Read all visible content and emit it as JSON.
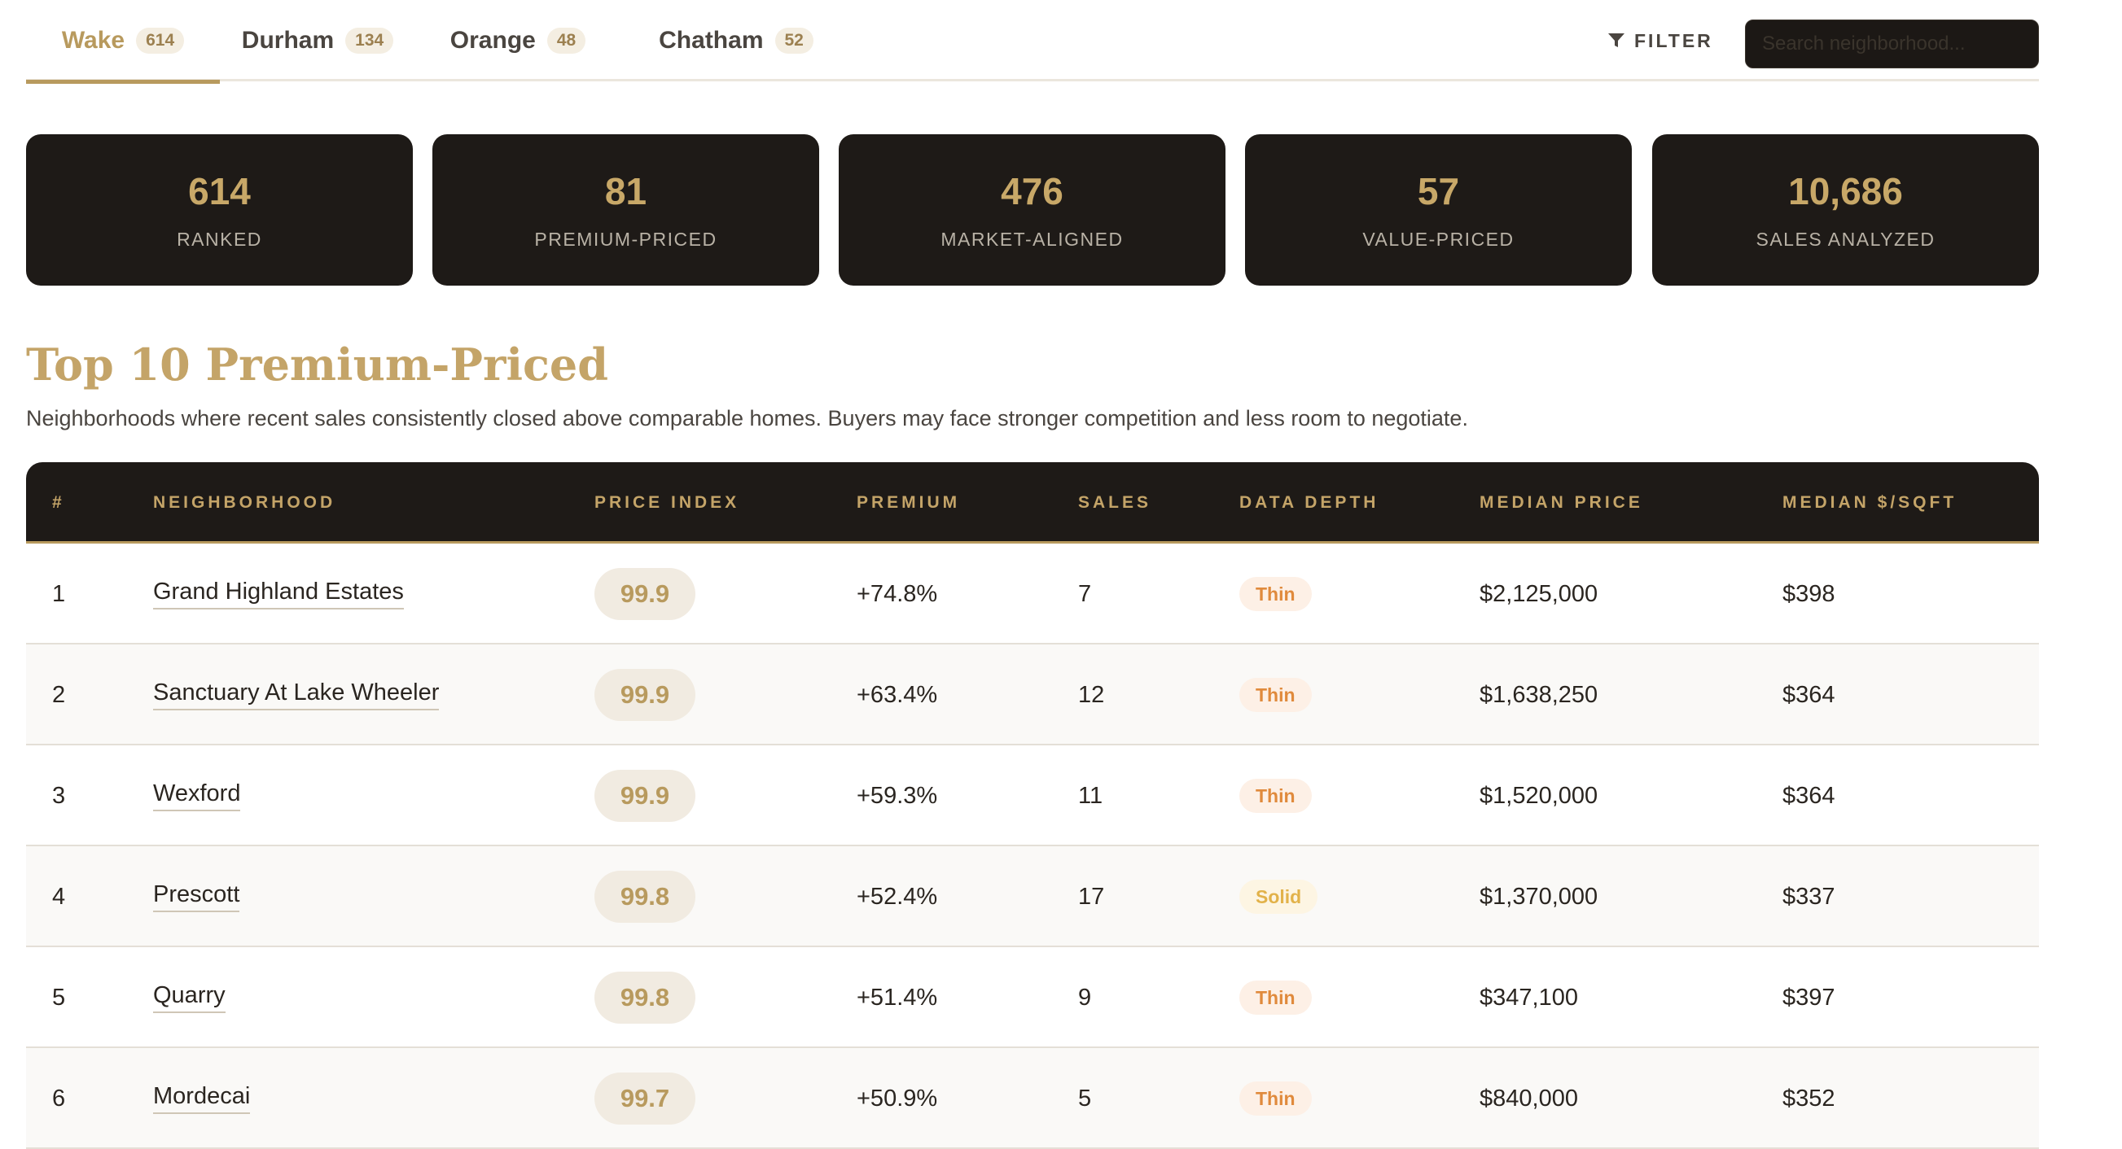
{
  "tabs": [
    {
      "label": "Wake",
      "count": "614",
      "active": true
    },
    {
      "label": "Durham",
      "count": "134",
      "active": false
    },
    {
      "label": "Orange",
      "count": "48",
      "active": false
    },
    {
      "label": "Chatham",
      "count": "52",
      "active": false
    }
  ],
  "filter": {
    "label": "FILTER",
    "icon": "filter-funnel-icon"
  },
  "search": {
    "placeholder": "Search neighborhood..."
  },
  "stats": [
    {
      "value": "614",
      "label": "RANKED"
    },
    {
      "value": "81",
      "label": "PREMIUM-PRICED"
    },
    {
      "value": "476",
      "label": "MARKET-ALIGNED"
    },
    {
      "value": "57",
      "label": "VALUE-PRICED"
    },
    {
      "value": "10,686",
      "label": "SALES ANALYZED"
    }
  ],
  "section": {
    "title": "Top 10 Premium-Priced",
    "description": "Neighborhoods where recent sales consistently closed above comparable homes. Buyers may face stronger competition and less room to negotiate."
  },
  "table": {
    "headers": {
      "rank": "#",
      "neighborhood": "NEIGHBORHOOD",
      "price_index": "PRICE INDEX",
      "premium": "PREMIUM",
      "sales": "SALES",
      "data_depth": "DATA DEPTH",
      "median_price": "MEDIAN PRICE",
      "median_sqft": "MEDIAN $/SQFT"
    },
    "rows": [
      {
        "rank": "1",
        "name": "Grand Highland Estates",
        "index": "99.9",
        "premium": "+74.8%",
        "sales": "7",
        "depth": "Thin",
        "price": "$2,125,000",
        "sqft": "$398"
      },
      {
        "rank": "2",
        "name": "Sanctuary At Lake Wheeler",
        "index": "99.9",
        "premium": "+63.4%",
        "sales": "12",
        "depth": "Thin",
        "price": "$1,638,250",
        "sqft": "$364"
      },
      {
        "rank": "3",
        "name": "Wexford",
        "index": "99.9",
        "premium": "+59.3%",
        "sales": "11",
        "depth": "Thin",
        "price": "$1,520,000",
        "sqft": "$364"
      },
      {
        "rank": "4",
        "name": "Prescott",
        "index": "99.8",
        "premium": "+52.4%",
        "sales": "17",
        "depth": "Solid",
        "price": "$1,370,000",
        "sqft": "$337"
      },
      {
        "rank": "5",
        "name": "Quarry",
        "index": "99.8",
        "premium": "+51.4%",
        "sales": "9",
        "depth": "Thin",
        "price": "$347,100",
        "sqft": "$397"
      },
      {
        "rank": "6",
        "name": "Mordecai",
        "index": "99.7",
        "premium": "+50.9%",
        "sales": "5",
        "depth": "Thin",
        "price": "$840,000",
        "sqft": "$352"
      }
    ]
  },
  "colors": {
    "accent_gold": "#b89a5e",
    "dark_panel": "#1e1a17",
    "thin_badge": "#e08a3c",
    "solid_badge": "#e2b24a"
  }
}
